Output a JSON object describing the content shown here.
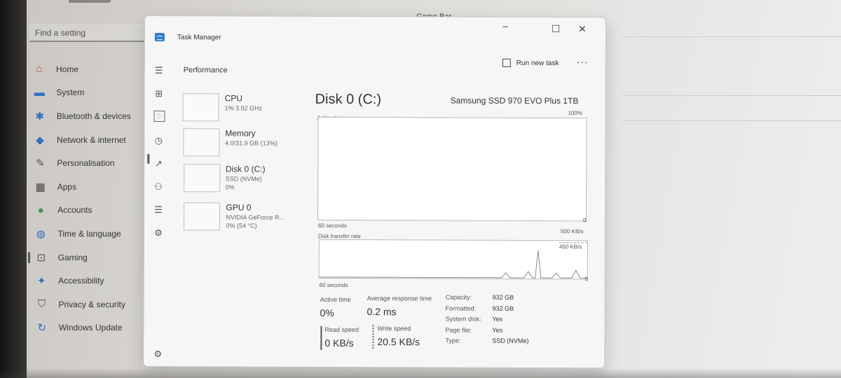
{
  "settings": {
    "search_placeholder": "Find a setting",
    "nav": [
      {
        "label": "Home",
        "icon": "home-icon",
        "glyph": "⌂",
        "color": "#b04a3a"
      },
      {
        "label": "System",
        "icon": "system-icon",
        "glyph": "▬",
        "color": "#2d6fc2"
      },
      {
        "label": "Bluetooth & devices",
        "icon": "bluetooth-icon",
        "glyph": "✱",
        "color": "#2d6fc2"
      },
      {
        "label": "Network & internet",
        "icon": "wifi-icon",
        "glyph": "◆",
        "color": "#2d6fc2"
      },
      {
        "label": "Personalisation",
        "icon": "brush-icon",
        "glyph": "✎",
        "color": "#555"
      },
      {
        "label": "Apps",
        "icon": "apps-icon",
        "glyph": "▦",
        "color": "#444"
      },
      {
        "label": "Accounts",
        "icon": "accounts-icon",
        "glyph": "●",
        "color": "#3a9a5a"
      },
      {
        "label": "Time & language",
        "icon": "globe-icon",
        "glyph": "◍",
        "color": "#2d6fc2"
      },
      {
        "label": "Gaming",
        "icon": "gaming-icon",
        "glyph": "⊡",
        "color": "#555"
      },
      {
        "label": "Accessibility",
        "icon": "accessibility-icon",
        "glyph": "✦",
        "color": "#2d6fc2"
      },
      {
        "label": "Privacy & security",
        "icon": "shield-icon",
        "glyph": "⛉",
        "color": "#555"
      },
      {
        "label": "Windows Update",
        "icon": "update-icon",
        "glyph": "↻",
        "color": "#2d6fc2"
      }
    ],
    "gamebar_label": "Game Bar"
  },
  "taskmanager": {
    "title": "Task Manager",
    "section": "Performance",
    "run_new_task": "Run new task",
    "more": "···",
    "devices": [
      {
        "name": "CPU",
        "sub": "1% 3.92 GHz",
        "sub2": ""
      },
      {
        "name": "Memory",
        "sub": "4.0/31.9 GB (13%)",
        "sub2": ""
      },
      {
        "name": "Disk 0 (C:)",
        "sub": "SSD (NVMe)",
        "sub2": "0%"
      },
      {
        "name": "GPU 0",
        "sub": "NVIDIA GeForce R...",
        "sub2": "0% (54 °C)"
      }
    ],
    "detail": {
      "title": "Disk 0 (C:)",
      "model": "Samsung SSD 970 EVO Plus 1TB",
      "active_label": "Active time",
      "active_max": "100%",
      "active_min": "0",
      "time_label1": "60 seconds",
      "transfer_label": "Disk transfer rate",
      "transfer_max": "500 KB/s",
      "transfer_mark": "450 KB/s",
      "transfer_min": "0",
      "time_label2": "60 seconds",
      "active_time_label": "Active time",
      "active_time_value": "0%",
      "avg_resp_label": "Average response time",
      "avg_resp_value": "0.2 ms",
      "read_label": "Read speed",
      "read_value": "0 KB/s",
      "write_label": "Write speed",
      "write_value": "20.5 KB/s",
      "props": [
        {
          "k": "Capacity:",
          "v": "932 GB"
        },
        {
          "k": "Formatted:",
          "v": "932 GB"
        },
        {
          "k": "System disk:",
          "v": "Yes"
        },
        {
          "k": "Page file:",
          "v": "Yes"
        },
        {
          "k": "Type:",
          "v": "SSD (NVMe)"
        }
      ]
    }
  }
}
